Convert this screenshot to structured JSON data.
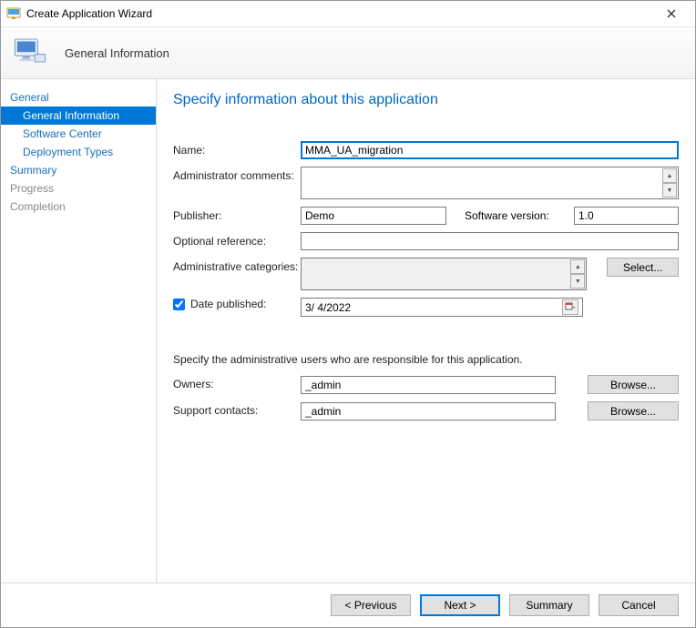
{
  "window": {
    "title": "Create Application Wizard"
  },
  "banner": {
    "title": "General Information"
  },
  "nav": {
    "groups": [
      {
        "label": "General",
        "muted": false,
        "items": [
          {
            "label": "General Information",
            "selected": true
          },
          {
            "label": "Software Center"
          },
          {
            "label": "Deployment Types"
          }
        ]
      },
      {
        "label": "Summary",
        "muted": false,
        "items": []
      },
      {
        "label": "Progress",
        "muted": true,
        "items": []
      },
      {
        "label": "Completion",
        "muted": true,
        "items": []
      }
    ]
  },
  "content": {
    "heading": "Specify information about this application",
    "labels": {
      "name": "Name:",
      "admin_comments": "Administrator comments:",
      "publisher": "Publisher:",
      "software_version": "Software version:",
      "optional_reference": "Optional reference:",
      "admin_categories": "Administrative categories:",
      "date_published": "Date published:",
      "sub": "Specify the administrative users who are responsible for this application.",
      "owners": "Owners:",
      "support_contacts": "Support contacts:"
    },
    "values": {
      "name": "MMA_UA_migration",
      "admin_comments": "",
      "publisher": "Demo",
      "software_version": "1.0",
      "optional_reference": "",
      "date_published_checked": true,
      "date_published": "3/  4/2022",
      "owners": "_admin",
      "support_contacts": "_admin"
    },
    "buttons": {
      "select": "Select...",
      "browse": "Browse..."
    }
  },
  "footer": {
    "previous": "< Previous",
    "next": "Next >",
    "summary": "Summary",
    "cancel": "Cancel"
  }
}
